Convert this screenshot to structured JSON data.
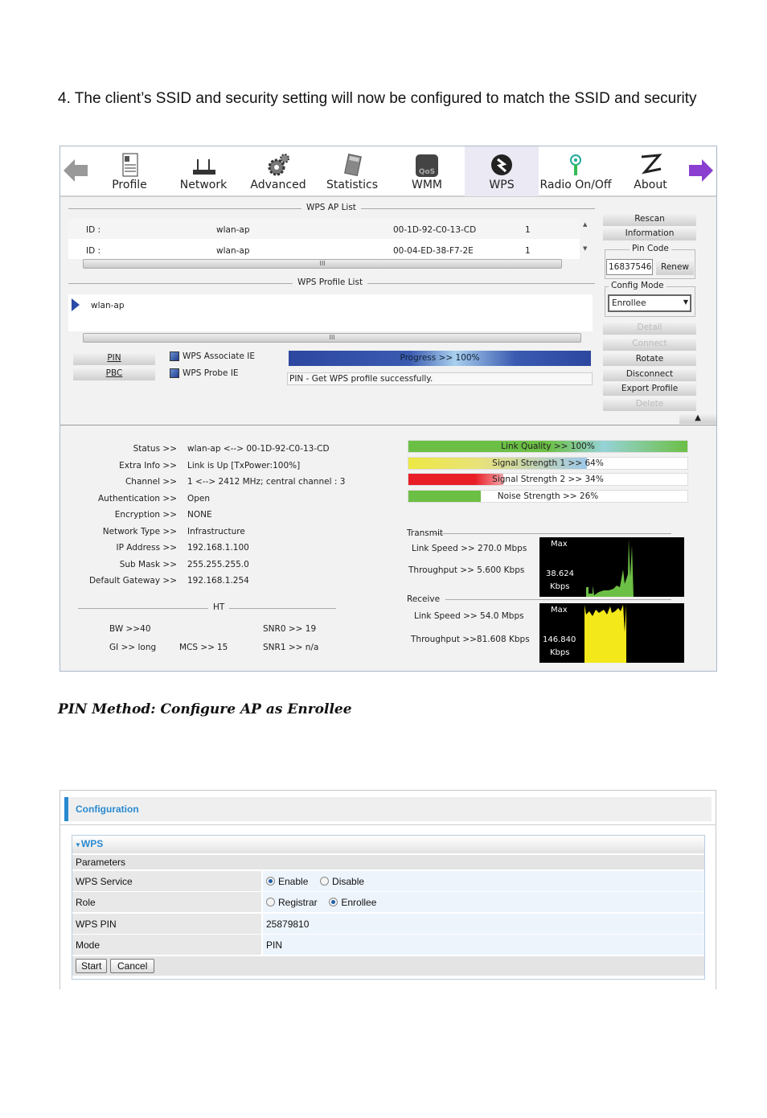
{
  "intro_text": "4. The client’s SSID and security setting will now be configured to match the SSID and security",
  "caption": "PIN Method: Configure AP as Enrollee",
  "utility": {
    "toolbar": [
      {
        "label": "Profile",
        "icon": "profile-icon"
      },
      {
        "label": "Network",
        "icon": "router-icon"
      },
      {
        "label": "Advanced",
        "icon": "gears-icon"
      },
      {
        "label": "Statistics",
        "icon": "calculator-icon"
      },
      {
        "label": "WMM",
        "icon": "qos-icon"
      },
      {
        "label": "WPS",
        "icon": "wps-icon",
        "selected": true
      },
      {
        "label": "Radio On/Off",
        "icon": "antenna-icon"
      },
      {
        "label": "About",
        "icon": "about-icon"
      }
    ],
    "ap_list_title": "WPS AP List",
    "ap_list": [
      {
        "id": "ID :",
        "ssid": "wlan-ap",
        "mac": "00-1D-92-C0-13-CD",
        "ch": "1"
      },
      {
        "id": "ID :",
        "ssid": "wlan-ap",
        "mac": "00-04-ED-38-F7-2E",
        "ch": "1"
      }
    ],
    "profile_list_title": "WPS Profile List",
    "profiles": [
      "wlan-ap"
    ],
    "pin_button": "PIN",
    "pbc_button": "PBC",
    "wps_associate_ie": "WPS Associate IE",
    "wps_probe_ie": "WPS Probe IE",
    "progress_label": "Progress >> 100%",
    "progress": 100,
    "status_message": "PIN - Get WPS profile successfully.",
    "buttons": {
      "rescan": "Rescan",
      "information": "Information",
      "renew": "Renew",
      "detail": "Detail",
      "connect": "Connect",
      "rotate": "Rotate",
      "disconnect": "Disconnect",
      "export": "Export Profile",
      "delete": "Delete"
    },
    "pin_code_label": "Pin Code",
    "pin_code": "16837546",
    "config_mode_label": "Config Mode",
    "config_mode": "Enrollee",
    "status": [
      [
        "Status >>",
        "wlan-ap <--> 00-1D-92-C0-13-CD"
      ],
      [
        "Extra Info >>",
        "Link is Up [TxPower:100%]"
      ],
      [
        "Channel >>",
        "1 <--> 2412 MHz; central channel : 3"
      ],
      [
        "Authentication >>",
        "Open"
      ],
      [
        "Encryption >>",
        "NONE"
      ],
      [
        "Network Type >>",
        "Infrastructure"
      ],
      [
        "IP Address >>",
        "192.168.1.100"
      ],
      [
        "Sub Mask >>",
        "255.255.255.0"
      ],
      [
        "Default Gateway >>",
        "192.168.1.254"
      ]
    ],
    "ht": {
      "title": "HT",
      "bw": "BW >>40",
      "gi": "GI >> long",
      "mcs_label": "MCS >>",
      "mcs": "15",
      "snr0": "SNR0 >>  19",
      "snr1": "SNR1 >>  n/a"
    },
    "bars": [
      {
        "label": "Link Quality >> 100%",
        "value": 100
      },
      {
        "label": "Signal Strength 1 >> 64%",
        "value": 64
      },
      {
        "label": "Signal Strength 2 >> 34%",
        "value": 34
      },
      {
        "label": "Noise Strength >> 26%",
        "value": 26
      }
    ],
    "transmit": {
      "title": "Transmit",
      "link_speed": "Link Speed >>  270.0 Mbps",
      "throughput": "Throughput >> 5.600 Kbps",
      "graph_max": "Max",
      "graph_value": "38.624",
      "graph_unit": "Kbps"
    },
    "receive": {
      "title": "Receive",
      "link_speed": "Link Speed >> 54.0 Mbps",
      "throughput": "Throughput >>81.608 Kbps",
      "graph_max": "Max",
      "graph_value": "146.840",
      "graph_unit": "Kbps"
    }
  },
  "router": {
    "header": "Configuration",
    "panel_title": "WPS",
    "params_title": "Parameters",
    "rows": {
      "service_label": "WPS Service",
      "enable": "Enable",
      "disable": "Disable",
      "role_label": "Role",
      "registrar": "Registrar",
      "enrollee": "Enrollee",
      "pin_label": "WPS PIN",
      "pin": "25879810",
      "mode_label": "Mode",
      "mode": "PIN"
    },
    "start": "Start",
    "cancel": "Cancel",
    "accent": "#2a8ad0"
  }
}
